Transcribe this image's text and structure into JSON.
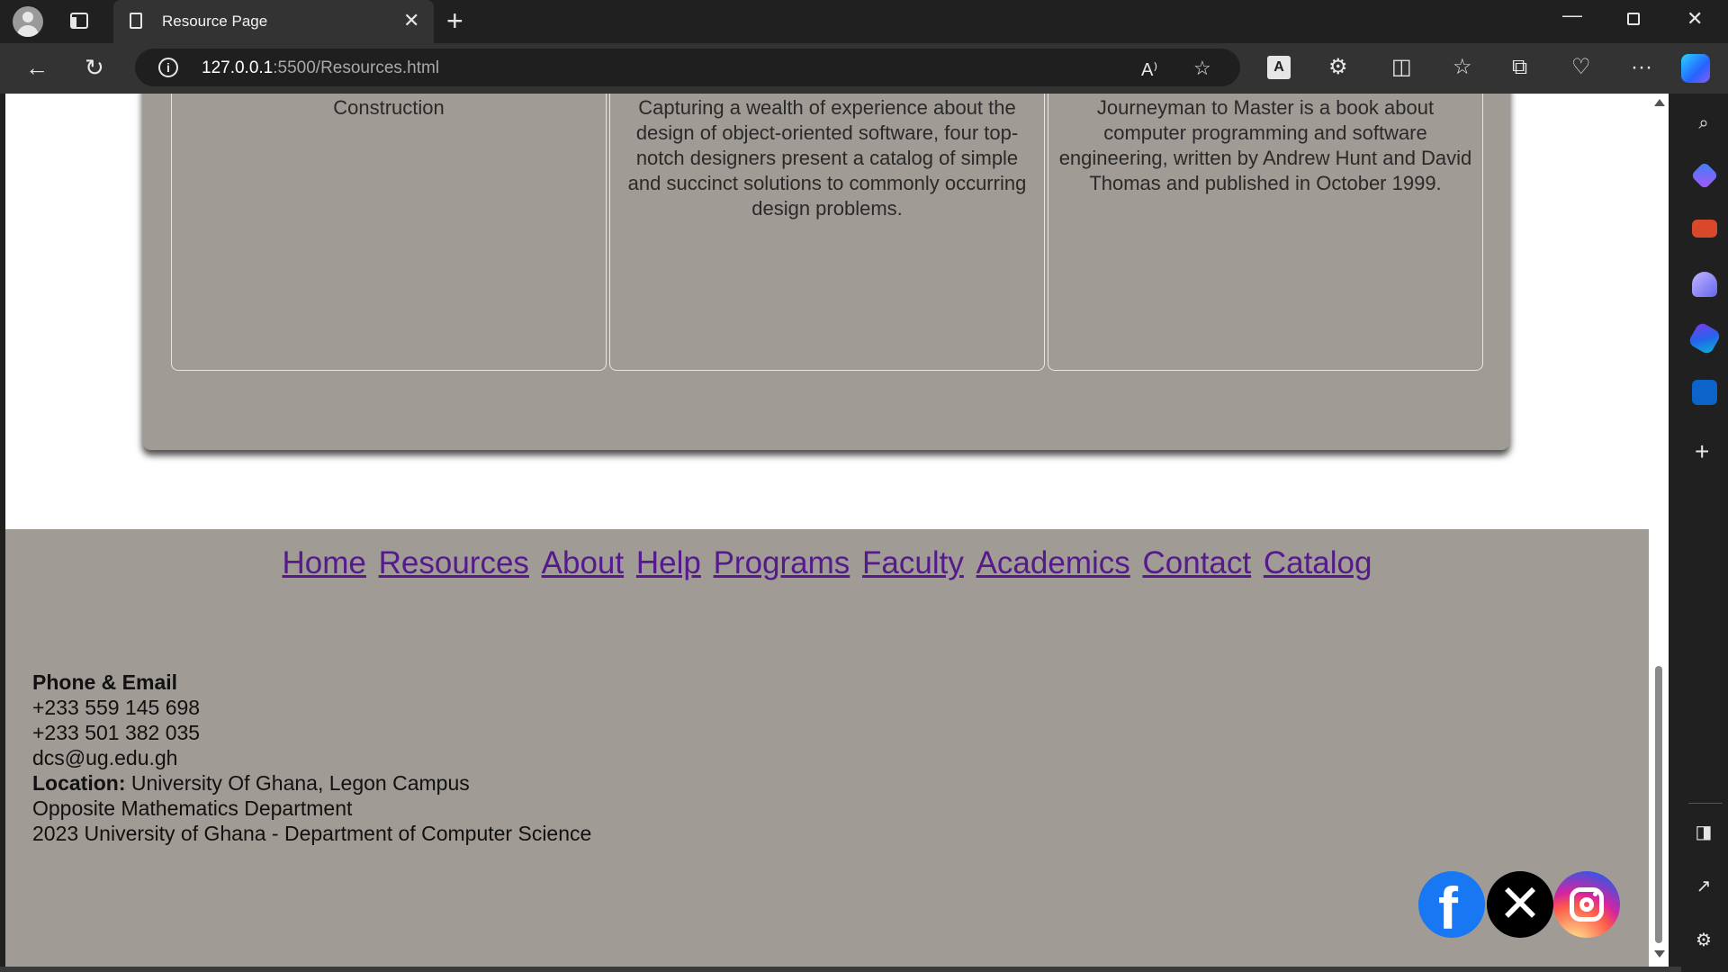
{
  "browser": {
    "tab_title": "Resource Page",
    "url_host": "127.0.0.1",
    "url_path": ":5500/Resources.html",
    "ext_label": "A"
  },
  "books": [
    {
      "text": "Construction"
    },
    {
      "text": "Capturing a wealth of experience about the design of object-oriented software, four top-notch designers present a catalog of simple and succinct solutions to commonly occurring design problems."
    },
    {
      "text": "Journeyman to Master is a book about computer programming and software engineering, written by Andrew Hunt and David Thomas and published in October 1999."
    }
  ],
  "footer": {
    "nav": [
      "Home",
      "Resources",
      "About",
      "Help",
      "Programs",
      "Faculty",
      "Academics",
      "Contact",
      "Catalog"
    ],
    "contact_heading": "Phone & Email",
    "phone_1": "+233 559 145 698",
    "phone_2": "+233 501 382 035",
    "email": "dcs@ug.edu.gh",
    "location_label": "Location:",
    "location_value": " University Of Ghana, Legon Campus",
    "location_detail": "Opposite Mathematics Department",
    "copyright": "2023 University of Ghana - Department of Computer Science"
  },
  "colors": {
    "panel": "#a09b94",
    "link": "#551a8b",
    "chrome_dark": "#202020",
    "chrome_toolbar": "#333333"
  },
  "icons": [
    "profile-icon",
    "tab-actions-icon",
    "page-icon",
    "close-icon",
    "plus-icon",
    "minimize-icon",
    "restore-icon",
    "back-icon",
    "refresh-icon",
    "info-icon",
    "read-aloud-icon",
    "favorite-star-icon",
    "extensions-icon",
    "split-screen-icon",
    "favorites-icon",
    "collections-icon",
    "browser-essentials-icon",
    "more-icon",
    "copilot-icon",
    "search-icon",
    "shopping-icon",
    "tools-icon",
    "games-icon",
    "office-icon",
    "outlook-icon",
    "facebook-icon",
    "x-icon",
    "instagram-icon"
  ]
}
